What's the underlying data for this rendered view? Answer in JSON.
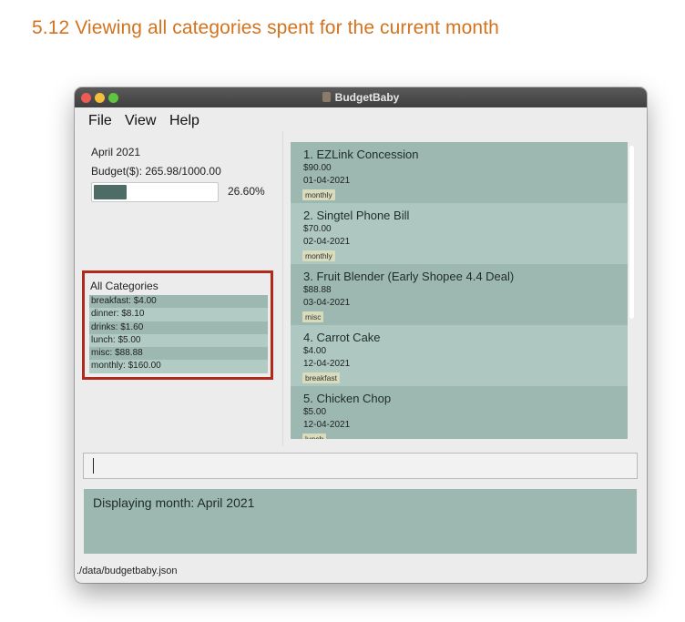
{
  "heading": "5.12 Viewing all categories spent for the current month",
  "window": {
    "title": "BudgetBaby",
    "menu": [
      "File",
      "View",
      "Help"
    ]
  },
  "budget": {
    "month": "April 2021",
    "budget_text": "Budget($): 265.98/1000.00",
    "progress_percent": 26.6,
    "percent_text": "26.60%"
  },
  "categories": {
    "title": "All Categories",
    "items": [
      "breakfast: $4.00",
      "dinner: $8.10",
      "drinks: $1.60",
      "lunch: $5.00",
      "misc: $88.88",
      "monthly: $160.00"
    ]
  },
  "expenses": [
    {
      "title": "1.  EZLink Concession",
      "amount": "$90.00",
      "date": "01-04-2021",
      "tag": "monthly"
    },
    {
      "title": "2.  Singtel Phone Bill",
      "amount": "$70.00",
      "date": "02-04-2021",
      "tag": "monthly"
    },
    {
      "title": "3.  Fruit Blender (Early Shopee 4.4 Deal)",
      "amount": "$88.88",
      "date": "03-04-2021",
      "tag": "misc"
    },
    {
      "title": "4.  Carrot Cake",
      "amount": "$4.00",
      "date": "12-04-2021",
      "tag": "breakfast"
    },
    {
      "title": "5.  Chicken Chop",
      "amount": "$5.00",
      "date": "12-04-2021",
      "tag": "lunch"
    }
  ],
  "command": {
    "value": ""
  },
  "result": "Displaying month: April 2021",
  "status": "./data/budgetbaby.json",
  "colors": {
    "heading": "#d4731d",
    "highlight": "#b02a1c",
    "list_bg": "#9cb8b0",
    "progress_fill": "#4e6c66"
  }
}
